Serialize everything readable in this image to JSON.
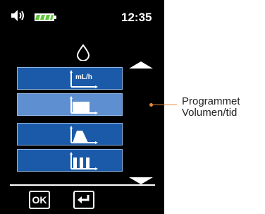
{
  "status": {
    "time": "12:35"
  },
  "icons": {
    "speaker": "speaker-icon",
    "battery": "battery-full-icon",
    "drop": "drop-icon",
    "scroll_up": "triangle-up-icon",
    "scroll_down": "triangle-down-icon"
  },
  "menu": {
    "items": [
      {
        "id": "rate",
        "unit_label": "mL/h",
        "icon": "rate-graph-icon"
      },
      {
        "id": "volume-time",
        "unit_label": "",
        "icon": "volume-time-graph-icon",
        "selected": true
      },
      {
        "id": "ramp",
        "unit_label": "",
        "icon": "ramp-graph-icon"
      },
      {
        "id": "sequential",
        "unit_label": "",
        "icon": "sequential-graph-icon"
      }
    ]
  },
  "softkeys": {
    "ok_label": "OK",
    "enter_icon": "enter-icon"
  },
  "callout": {
    "line1": "Programmet",
    "line2": "Volumen/tid"
  },
  "colors": {
    "menu_item": "#1a5aa8",
    "menu_item_selected": "#5e8fd0",
    "callout": "#e08a3c",
    "battery": "#5ec43a"
  }
}
